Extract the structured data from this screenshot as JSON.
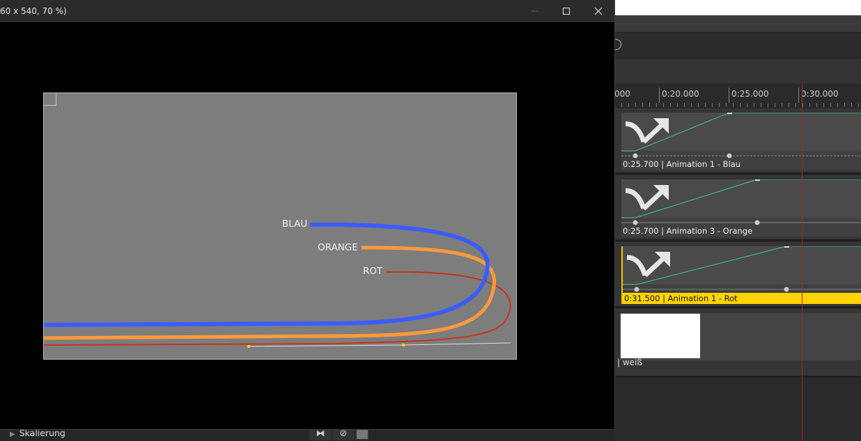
{
  "preview_window": {
    "title": "60 x 540, 70 %)",
    "minimize_icon": "minimize-icon",
    "maximize_icon": "maximize-icon",
    "close_icon": "close-icon",
    "curves": [
      {
        "label": "BLAU",
        "color": "#3b5cff"
      },
      {
        "label": "ORANGE",
        "color": "#ff9a3c"
      },
      {
        "label": "ROT",
        "color": "#c8331c"
      }
    ]
  },
  "timeline": {
    "ruler": [
      "000",
      "0:20.000",
      "0:25.000",
      "0:30.000"
    ],
    "tracks": [
      {
        "label": "0:25.700 | Animation 1 - Blau",
        "selected": false,
        "icon": "transition-arrow-icon"
      },
      {
        "label": "0:25.700 | Animation 3 - Orange",
        "selected": false,
        "icon": "transition-arrow-icon"
      },
      {
        "label": "0:31.500 | Animation 1 - Rot",
        "selected": true,
        "icon": "transition-arrow-icon"
      },
      {
        "label": "| weiß",
        "swatch_color": "#ffffff"
      }
    ],
    "playhead_color": "#b32020",
    "keyframe_line_color": "#3cb878",
    "selected_color": "#ffd400"
  },
  "bottom_bar": {
    "scaling_label": "Skalierung",
    "tools": [
      "bowtie-icon",
      "no-entry-icon",
      "square-icon"
    ]
  }
}
